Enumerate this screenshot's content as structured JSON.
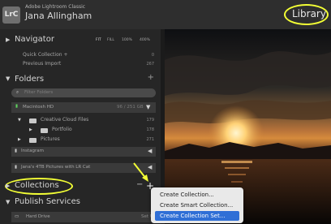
{
  "app": {
    "logo": "LrC",
    "name": "Adobe Lightroom Classic",
    "user": "Jana Allingham",
    "module": "Library"
  },
  "navigator": {
    "label": "Navigator",
    "zoom_options": [
      "FIT",
      "FILL",
      "100%",
      "400%"
    ]
  },
  "catalog": {
    "items": [
      {
        "label": "Quick Collection +",
        "count": "0"
      },
      {
        "label": "Previous Import",
        "count": "267"
      }
    ]
  },
  "folders": {
    "label": "Folders",
    "filter_placeholder": "Filter Folders",
    "volume": {
      "label": "Macintosh HD",
      "size": "96 / 251 GB"
    },
    "items": [
      {
        "label": "Creative Cloud Files",
        "count": "179"
      },
      {
        "label": "Portfolio",
        "count": "178"
      },
      {
        "label": "Pictures",
        "count": "271"
      }
    ],
    "other_volumes": [
      "Instagram",
      "Jana's 4TB Pictures with LR Cat"
    ]
  },
  "collections": {
    "label": "Collections",
    "minus": "−",
    "plus": "+"
  },
  "publish_services": {
    "label": "Publish Services",
    "first_service": "Hard Drive",
    "first_service_action": "Set Up..."
  },
  "menu": {
    "items": [
      {
        "label": "Create Collection..."
      },
      {
        "label": "Create Smart Collection..."
      },
      {
        "label": "Create Collection Set..."
      }
    ],
    "active_index": 2
  },
  "colors": {
    "annotation": "#f3ff35",
    "menu_highlight": "#2f6fd6"
  }
}
